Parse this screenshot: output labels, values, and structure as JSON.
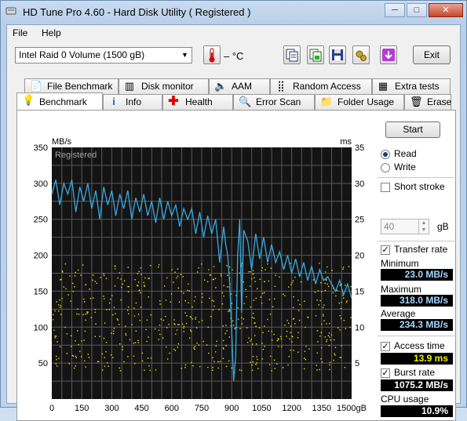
{
  "window": {
    "title": "HD Tune Pro 4.60 - Hard Disk Utility ( Registered )",
    "controls": {
      "minimize": "─",
      "maximize": "□",
      "close": "✕"
    }
  },
  "menu": {
    "file_label": "File",
    "help_label": "Help"
  },
  "toolbar": {
    "drive": "Intel   Raid 0 Volume (1500 gB)",
    "temperature": "– °C",
    "exit_label": "Exit",
    "icons": [
      "copy-text-icon",
      "copy-screenshot-icon",
      "save-icon",
      "options-icon",
      "download-icon"
    ]
  },
  "tabs_top": [
    {
      "label": "File Benchmark",
      "icon": "file-benchmark-icon"
    },
    {
      "label": "Disk monitor",
      "icon": "disk-monitor-icon"
    },
    {
      "label": "AAM",
      "icon": "speaker-icon"
    },
    {
      "label": "Random Access",
      "icon": "random-access-icon"
    },
    {
      "label": "Extra tests",
      "icon": "extra-tests-icon"
    }
  ],
  "tabs_bottom": [
    {
      "label": "Benchmark",
      "icon": "benchmark-icon",
      "active": true
    },
    {
      "label": "Info",
      "icon": "info-icon"
    },
    {
      "label": "Health",
      "icon": "health-icon"
    },
    {
      "label": "Error Scan",
      "icon": "error-scan-icon"
    },
    {
      "label": "Folder Usage",
      "icon": "folder-icon"
    },
    {
      "label": "Erase",
      "icon": "erase-icon"
    }
  ],
  "controls": {
    "start_label": "Start",
    "read_label": "Read",
    "write_label": "Write",
    "mode": "read",
    "short_stroke_label": "Short stroke",
    "short_stroke_checked": false,
    "short_stroke_value": "40",
    "short_stroke_unit": "gB",
    "transfer_rate_label": "Transfer rate",
    "transfer_rate_checked": true,
    "access_time_label": "Access time",
    "access_time_checked": true,
    "burst_rate_label": "Burst rate",
    "burst_rate_checked": true
  },
  "results": {
    "minimum_label": "Minimum",
    "minimum": "23.0 MB/s",
    "maximum_label": "Maximum",
    "maximum": "318.0 MB/s",
    "average_label": "Average",
    "average": "234.3 MB/s",
    "access_time": "13.9 ms",
    "burst_rate": "1075.2 MB/s",
    "cpu_usage_label": "CPU usage",
    "cpu_usage": "10.9%"
  },
  "chart_data": {
    "type": "line",
    "watermark": "Registered",
    "left_unit": "MB/s",
    "right_unit": "ms",
    "x_unit": "gB",
    "xlim": [
      0,
      1500
    ],
    "ylim_left": [
      0,
      350
    ],
    "ylim_right": [
      0,
      35
    ],
    "x_ticks": [
      0,
      150,
      300,
      450,
      600,
      750,
      900,
      1050,
      1200,
      1350,
      1500
    ],
    "x_tick_labels": [
      "0",
      "150",
      "300",
      "450",
      "600",
      "750",
      "900",
      "1050",
      "1200",
      "1350",
      "1500gB"
    ],
    "y_ticks_left": [
      50,
      100,
      150,
      200,
      250,
      300,
      350
    ],
    "y_ticks_right": [
      5,
      10,
      15,
      20,
      25,
      30,
      35
    ],
    "grid": true,
    "line_color": "#3aa8e0",
    "dot_color": "#e6e600",
    "series": [
      {
        "name": "Transfer rate",
        "x": [
          0,
          20,
          40,
          60,
          80,
          100,
          120,
          140,
          160,
          180,
          200,
          220,
          240,
          260,
          280,
          300,
          320,
          340,
          360,
          380,
          400,
          420,
          440,
          460,
          480,
          500,
          520,
          540,
          560,
          580,
          600,
          620,
          640,
          660,
          680,
          700,
          720,
          740,
          760,
          780,
          800,
          820,
          840,
          860,
          870,
          880,
          890,
          900,
          910,
          920,
          930,
          940,
          950,
          960,
          980,
          1000,
          1020,
          1040,
          1060,
          1080,
          1100,
          1120,
          1140,
          1160,
          1180,
          1200,
          1220,
          1240,
          1260,
          1280,
          1300,
          1320,
          1340,
          1360,
          1380,
          1400,
          1420,
          1440,
          1460,
          1480,
          1500
        ],
        "values": [
          285,
          305,
          270,
          300,
          285,
          305,
          260,
          295,
          275,
          300,
          265,
          290,
          250,
          295,
          270,
          290,
          255,
          285,
          265,
          290,
          250,
          280,
          260,
          285,
          255,
          275,
          245,
          280,
          250,
          275,
          255,
          270,
          240,
          265,
          250,
          265,
          230,
          260,
          225,
          255,
          230,
          250,
          190,
          240,
          215,
          200,
          160,
          95,
          25,
          60,
          200,
          250,
          120,
          235,
          220,
          180,
          230,
          195,
          225,
          190,
          215,
          190,
          205,
          180,
          200,
          175,
          195,
          170,
          190,
          165,
          185,
          160,
          180,
          165,
          170,
          160,
          150,
          165,
          145,
          160,
          140
        ]
      }
    ],
    "access_time_points_ms": {
      "count": 600,
      "range_ms": [
        4,
        19
      ]
    }
  }
}
